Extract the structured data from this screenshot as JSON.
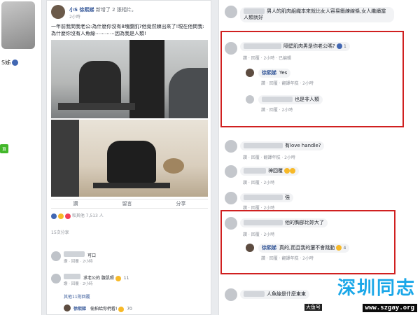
{
  "left": {
    "name_fragment": "S姊",
    "tag": "頁"
  },
  "post": {
    "author": "小S 徐熙娣",
    "author_rest": "新增了 2 張相片。",
    "time": "2小時",
    "text": "一年前我問我老公:為什麼你沒有8塊腹肌?他竟然練出來了!現在他問我:為什麼你沒有人魚線⋯⋯⋯⋯因為我是人類!",
    "reactions": "和其他 7,513 人",
    "actions": [
      "讚",
      "留言",
      "分享"
    ],
    "shares": "15次分享",
    "comments": [
      {
        "text": "可口",
        "meta": "讚 · 回覆 · 2小時"
      },
      {
        "text": "求老公的 腹肌照",
        "meta": "讚 · 回覆 · 2小時",
        "count": "11"
      },
      {
        "text": "其他11則回覆",
        "meta": ""
      },
      {
        "name": "徐熙娣",
        "text": "偷拍給你們看!",
        "count": "70"
      }
    ]
  },
  "panel": {
    "comments": [
      {
        "text": "男人的肌肉組織本來就比女人容易鍛練線條,女人繼續當人類就好",
        "meta": ""
      },
      {
        "text": "隔壁肌肉男是你老公嗎?",
        "count": "1",
        "meta": "讚 · 回覆 · 2小時 · 已編輯"
      },
      {
        "name": "徐熙娣",
        "text": "Yes",
        "meta": "讚 · 回覆 · 翻譯年糕 · 2小時"
      },
      {
        "text": "也是非人類",
        "meta": "讚 · 回覆 · 2小時"
      },
      {
        "text": "有love handle?",
        "meta": "讚 · 回覆 · 翻譯年糕 · 2小時"
      },
      {
        "text": "神回覆",
        "meta": "讚 · 回覆 · 2小時"
      },
      {
        "text": "強",
        "meta": "讚 · 回覆 · 2小時"
      },
      {
        "text": "他的胸部比妳大了",
        "meta": "讚 · 回覆 · 2小時"
      },
      {
        "name": "徐熙娣",
        "text": "真的,而且我的還不會跳動",
        "count": "4",
        "meta": "讚 · 回覆 · 翻譯年糕 · 2小時"
      },
      {
        "text": "人魚線是什麼東東",
        "meta": ""
      }
    ]
  },
  "watermark": {
    "title": "深圳同志",
    "url": "www.szgay.org",
    "small": "大鱼号"
  },
  "colors": {
    "highlight": "#d02020",
    "link": "#365899",
    "watermark": "#1aa7e8"
  }
}
